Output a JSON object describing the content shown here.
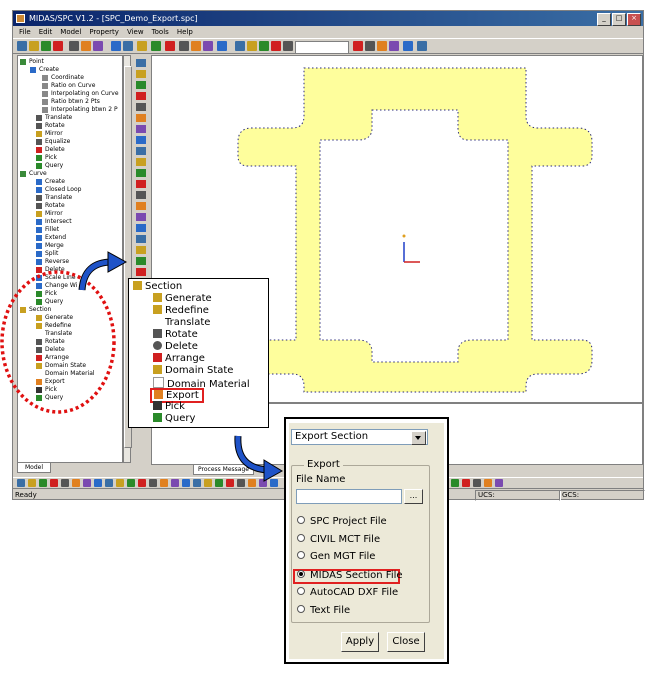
{
  "window": {
    "title": "MIDAS/SPC V1.2 - [SPC_Demo_Export.spc]"
  },
  "menu": [
    "File",
    "Edit",
    "Model",
    "Property",
    "View",
    "Tools",
    "Help"
  ],
  "tree": {
    "point": {
      "label": "Point",
      "create": "Create",
      "create_items": [
        "Coordinate",
        "Ratio on Curve",
        "Interpolating on Curve",
        "Ratio btwn 2 Pts",
        "Interpolating btwn 2 P"
      ],
      "items": [
        "Translate",
        "Rotate",
        "Mirror",
        "Equalize",
        "Delete",
        "Pick",
        "Query"
      ]
    },
    "curve": {
      "label": "Curve",
      "items": [
        "Create",
        "Closed Loop",
        "Translate",
        "Rotate",
        "Mirror",
        "Intersect",
        "Fillet",
        "Extend",
        "Merge",
        "Split",
        "Reverse",
        "Delete",
        "Scale Line",
        "Change Wi",
        "Pick",
        "Query"
      ]
    },
    "section": {
      "label": "Section",
      "items": [
        "Generate",
        "Redefine",
        "Translate",
        "Rotate",
        "Delete",
        "Arrange",
        "Domain State",
        "Domain Material",
        "Export",
        "Pick",
        "Query"
      ]
    },
    "tab_model": "Model"
  },
  "messages_tab": "Process Message",
  "status": {
    "text": "Ready",
    "ucs": "UCS:",
    "gcs": "GCS:"
  },
  "zoom_panel": {
    "root": "Section",
    "items": [
      "Generate",
      "Redefine",
      "Translate",
      "Rotate",
      "Delete",
      "Arrange",
      "Domain State",
      "Domain Material",
      "Export",
      "Pick",
      "Query"
    ],
    "highlighted": "Export"
  },
  "export_dialog": {
    "command": "Export Section",
    "group_label": "Export",
    "file_name_label": "File Name",
    "file_name_value": "",
    "browse_label": "...",
    "options": [
      "SPC Project File",
      "CIVIL MCT File",
      "Gen MGT File",
      "MIDAS Section File",
      "AutoCAD DXF File",
      "Text File"
    ],
    "selected": "MIDAS Section File",
    "apply_label": "Apply",
    "close_label": "Close"
  },
  "colors": {
    "section_fill": "#fefe9c",
    "section_edge": "#2a2a7a",
    "highlight": "#e02020",
    "arrow": "#1f53c8",
    "callout": "#e01010"
  }
}
